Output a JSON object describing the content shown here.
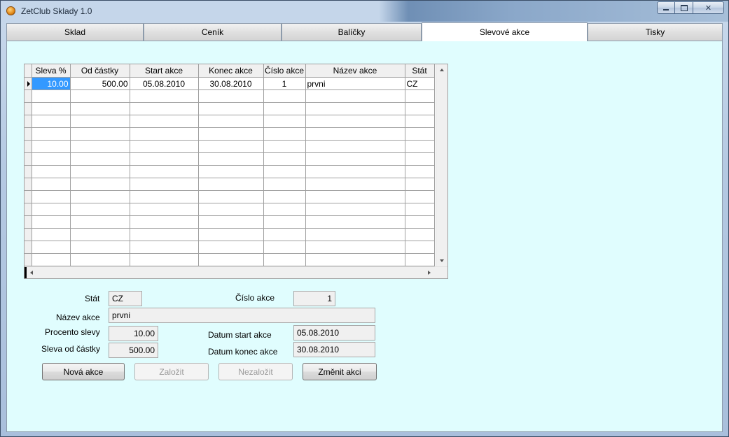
{
  "window": {
    "title": "ZetClub Sklady 1.0"
  },
  "tabs": [
    {
      "label": "Sklad"
    },
    {
      "label": "Ceník"
    },
    {
      "label": "Balíčky"
    },
    {
      "label": "Slevové akce",
      "active": true
    },
    {
      "label": "Tisky"
    }
  ],
  "grid": {
    "columns": [
      "Sleva %",
      "Od částky",
      "Start akce",
      "Konec akce",
      "Číslo akce",
      "Název akce",
      "Stát"
    ],
    "rows": [
      [
        "10.00",
        "500.00",
        "05.08.2010",
        "30.08.2010",
        "1",
        "prvni",
        "CZ"
      ]
    ]
  },
  "form": {
    "stat_label": "Stát",
    "stat_value": "CZ",
    "cislo_label": "Číslo akce",
    "cislo_value": "1",
    "nazev_label": "Název akce",
    "nazev_value": "prvni",
    "procento_label": "Procento slevy",
    "procento_value": "10.00",
    "od_castky_label": "Sleva od částky",
    "od_castky_value": "500.00",
    "start_label": "Datum start akce",
    "start_value": "05.08.2010",
    "konec_label": "Datum konec akce",
    "konec_value": "30.08.2010"
  },
  "buttons": {
    "nova": "Nová akce",
    "zalozit": "Založit",
    "nezalozit": "Nezaložit",
    "zmenit": "Změnit akci"
  },
  "colors": {
    "pane_bg": "#e0fdfe",
    "selection": "#3399ff"
  }
}
